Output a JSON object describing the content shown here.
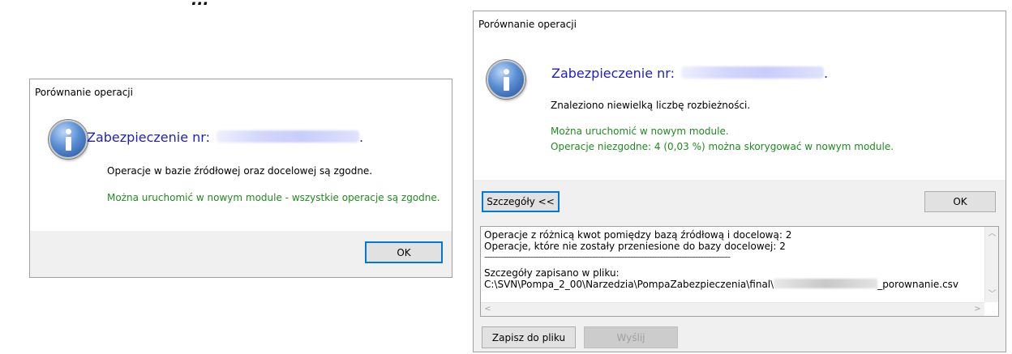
{
  "top_caption": "...",
  "dialog_left": {
    "title": "Porównanie operacji",
    "heading": "Zabezpieczenie nr:",
    "heading_suffix": ".",
    "message": "Operacje w bazie źródłowej oraz docelowej są zgodne.",
    "status": "Można uruchomić w nowym module - wszystkie operacje są zgodne.",
    "ok_label": "OK"
  },
  "dialog_right": {
    "title": "Porównanie operacji",
    "heading": "Zabezpieczenie nr:",
    "heading_suffix": ".",
    "message": "Znaleziono niewielką liczbę rozbieżności.",
    "status_line1": "Można uruchomić w nowym module.",
    "status_line2": "Operacje niezgodne: 4 (0,03 %) można skorygować w nowym module.",
    "details_toggle_label": "Szczegóły <<",
    "ok_label": "OK",
    "details": {
      "line1": "Operacje z różnicą kwot pomiędzy bazą źródłową i docelową: 2",
      "line2": "Operacje, które nie zostały przeniesione do bazy docelowej: 2",
      "separator": "-------------------------------------------------------------------------------------------",
      "line3": "Szczegóły zapisano w pliku:",
      "path_prefix": "C:\\SVN\\Pompa_2_00\\Narzedzia\\PompaZabezpieczenia\\final\\",
      "path_suffix": "_porownanie.csv"
    },
    "save_label": "Zapisz do pliku",
    "send_label": "Wyślij"
  }
}
